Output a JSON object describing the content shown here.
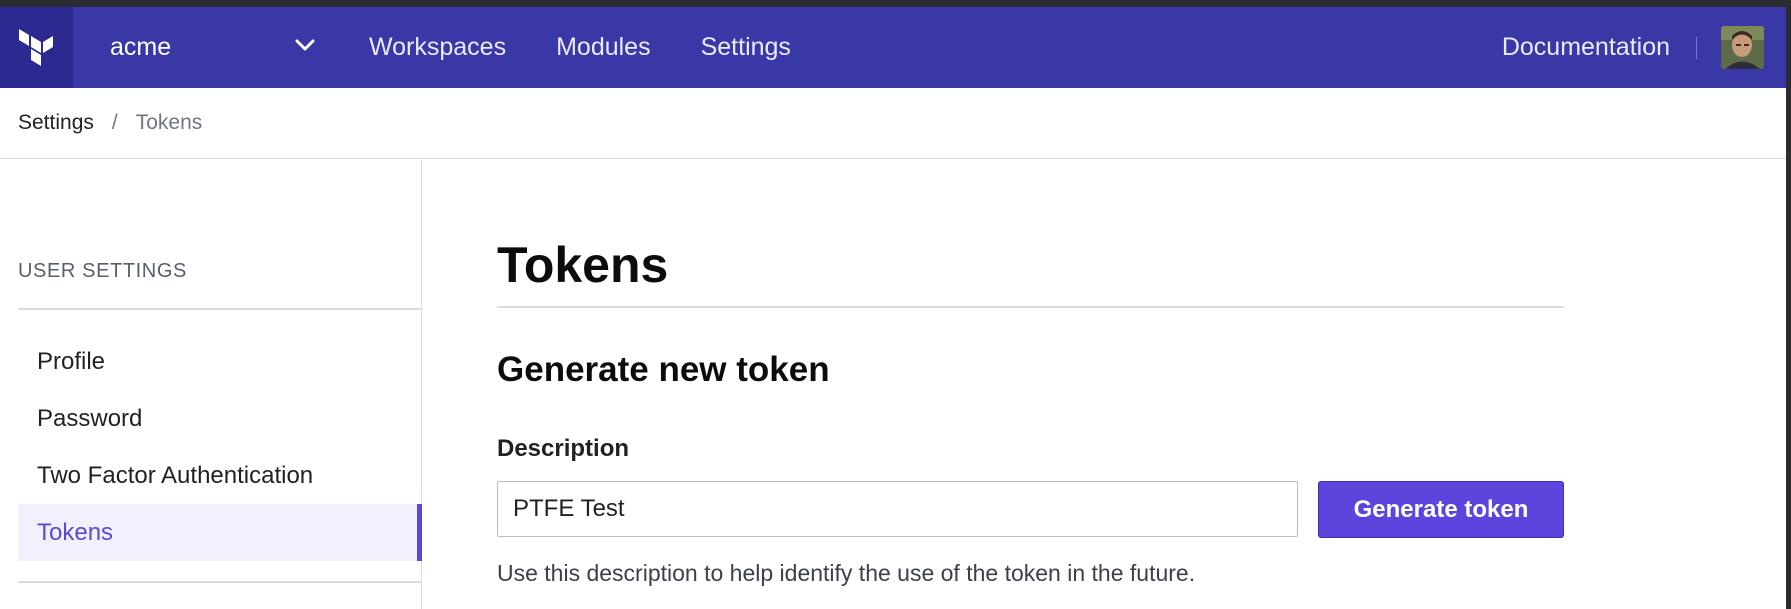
{
  "colors": {
    "navbar_bg": "#3a37a6",
    "logo_bg": "#2c2990",
    "accent": "#5b45dd",
    "active_item_bg": "#f1f0fc"
  },
  "navbar": {
    "logo_icon": "terraform-logo-icon",
    "org_name": "acme",
    "org_dropdown_icon": "chevron-down-icon",
    "links": [
      "Workspaces",
      "Modules",
      "Settings"
    ],
    "documentation": "Documentation",
    "avatar_icon": "user-avatar"
  },
  "breadcrumb": {
    "parent": "Settings",
    "separator": "/",
    "current": "Tokens"
  },
  "sidebar": {
    "heading": "USER SETTINGS",
    "items": [
      {
        "label": "Profile",
        "active": false
      },
      {
        "label": "Password",
        "active": false
      },
      {
        "label": "Two Factor Authentication",
        "active": false
      },
      {
        "label": "Tokens",
        "active": true
      }
    ]
  },
  "main": {
    "title": "Tokens",
    "section_title": "Generate new token",
    "description_label": "Description",
    "description_value": "PTFE Test",
    "generate_button": "Generate token",
    "help_text": "Use this description to help identify the use of the token in the future."
  }
}
